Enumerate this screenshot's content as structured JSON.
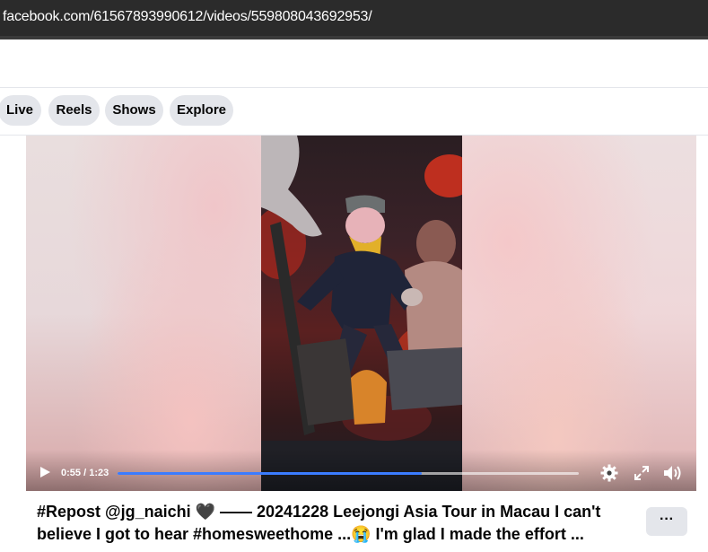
{
  "browser": {
    "url": "facebook.com/61567893990612/videos/559808043692953/"
  },
  "nav": {
    "tabs": [
      {
        "label": "Live"
      },
      {
        "label": "Reels"
      },
      {
        "label": "Shows"
      },
      {
        "label": "Explore"
      }
    ]
  },
  "video": {
    "current_time": "0:55",
    "separator": " / ",
    "duration": "1:23",
    "progress_fraction": 0.66,
    "accent_color": "#3b7cff",
    "icons": [
      "play-icon",
      "settings-gear-icon",
      "fullscreen-icon",
      "volume-icon"
    ]
  },
  "post": {
    "caption_line1": "#Repost @jg_naichi 🖤 —— 20241228 Leejongi Asia Tour in Macau I can't",
    "caption_line2": "believe I got to hear #homesweethome ...😭 I'm glad I made the effort ...",
    "more_label": "···"
  }
}
